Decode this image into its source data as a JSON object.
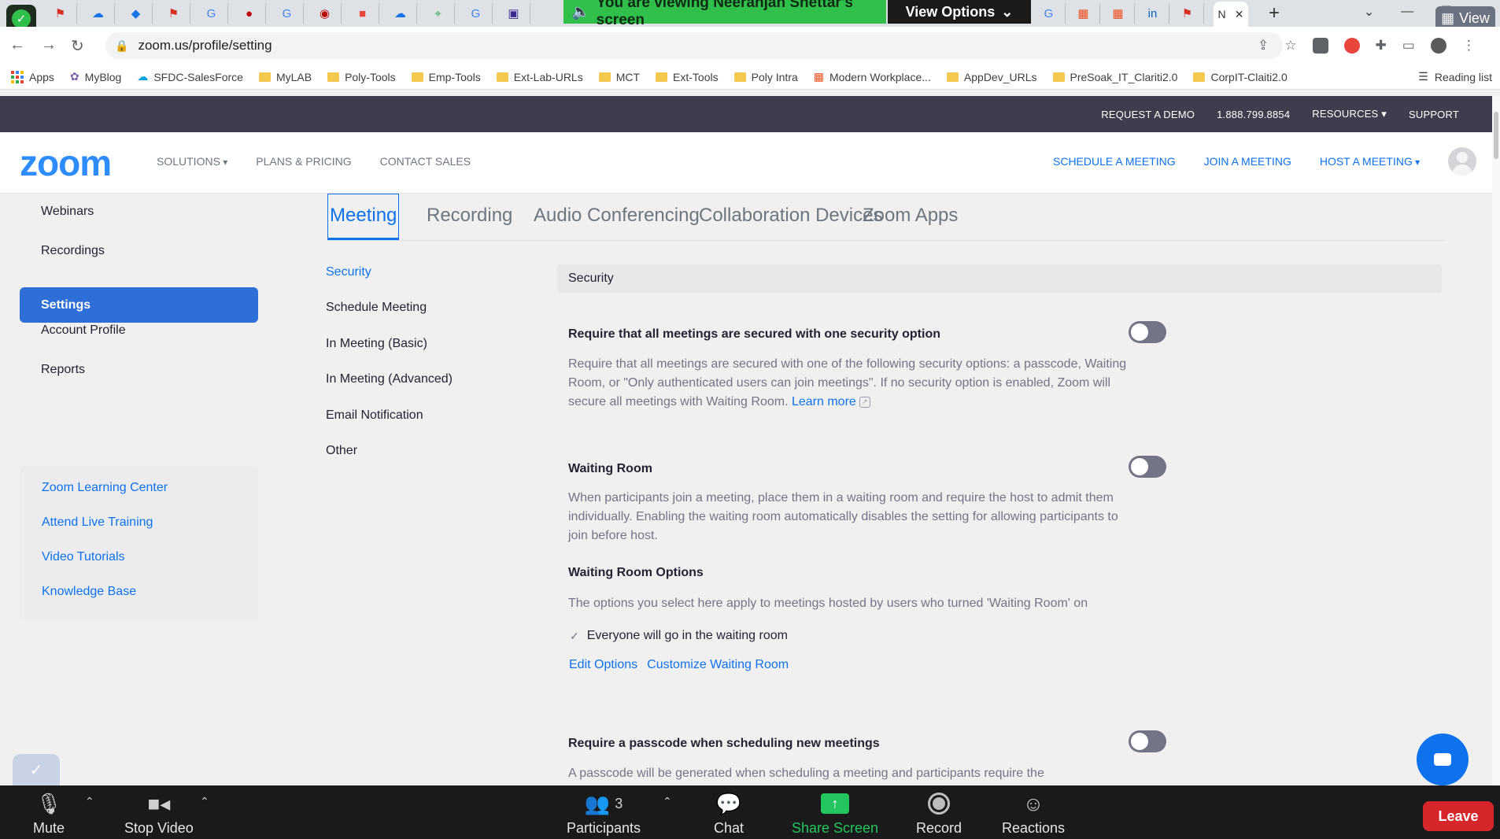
{
  "browser": {
    "viewing_banner": "You are viewing Neeranjan Shettar's screen",
    "view_options": "View Options",
    "view_chip": "View",
    "url": "zoom.us/profile/setting"
  },
  "bookmarks": [
    {
      "label": "Apps"
    },
    {
      "label": "MyBlog"
    },
    {
      "label": "SFDC-SalesForce"
    },
    {
      "label": "MyLAB"
    },
    {
      "label": "Poly-Tools"
    },
    {
      "label": "Emp-Tools"
    },
    {
      "label": "Ext-Lab-URLs"
    },
    {
      "label": "MCT"
    },
    {
      "label": "Ext-Tools"
    },
    {
      "label": "Poly Intra"
    },
    {
      "label": "Modern Workplace..."
    },
    {
      "label": "AppDev_URLs"
    },
    {
      "label": "PreSoak_IT_Clariti2.0"
    },
    {
      "label": "CorpIT-Claiti2.0"
    }
  ],
  "reading_list": "Reading list",
  "zoom_topbar": {
    "request_demo": "REQUEST A DEMO",
    "phone": "1.888.799.8854",
    "resources": "RESOURCES",
    "support": "SUPPORT"
  },
  "zoom_header": {
    "logo": "zoom",
    "solutions": "SOLUTIONS",
    "plans": "PLANS & PRICING",
    "contact": "CONTACT SALES",
    "schedule": "SCHEDULE A MEETING",
    "join": "JOIN A MEETING",
    "host": "HOST A MEETING"
  },
  "sidebar": {
    "items": [
      {
        "label": "Webinars"
      },
      {
        "label": "Recordings"
      },
      {
        "label": "Settings"
      },
      {
        "label": "Account Profile"
      },
      {
        "label": "Reports"
      }
    ],
    "help_links": [
      {
        "label": "Zoom Learning Center"
      },
      {
        "label": "Attend Live Training"
      },
      {
        "label": "Video Tutorials"
      },
      {
        "label": "Knowledge Base"
      }
    ]
  },
  "main": {
    "tabs": [
      {
        "label": "Meeting"
      },
      {
        "label": "Recording"
      },
      {
        "label": "Audio Conferencing"
      },
      {
        "label": "Collaboration Devices"
      },
      {
        "label": "Zoom Apps"
      }
    ],
    "sub_nav": [
      {
        "label": "Security"
      },
      {
        "label": "Schedule Meeting"
      },
      {
        "label": "In Meeting (Basic)"
      },
      {
        "label": "In Meeting (Advanced)"
      },
      {
        "label": "Email Notification"
      },
      {
        "label": "Other"
      }
    ],
    "section_header": "Security",
    "settings": [
      {
        "title": "Require that all meetings are secured with one security option",
        "desc": "Require that all meetings are secured with one of the following security options: a passcode, Waiting Room, or \"Only authenticated users can join meetings\". If no security option is enabled, Zoom will secure all meetings with Waiting Room.",
        "link": "Learn more",
        "enabled": false
      },
      {
        "title": "Waiting Room",
        "desc": "When participants join a meeting, place them in a waiting room and require the host to admit them individually. Enabling the waiting room automatically disables the setting for allowing participants to join before host.",
        "enabled": false
      },
      {
        "title": "Require a passcode when scheduling new meetings",
        "desc": "A passcode will be generated when scheduling a meeting and participants require the",
        "enabled": false
      }
    ],
    "waiting_room_options": {
      "title": "Waiting Room Options",
      "desc": "The options you select here apply to meetings hosted by users who turned 'Waiting Room' on",
      "check_item": "Everyone will go in the waiting room",
      "edit_options": "Edit Options",
      "customize": "Customize Waiting Room"
    }
  },
  "meeting_bar": {
    "mute": "Mute",
    "stop_video": "Stop Video",
    "participants": "Participants",
    "participant_count": "3",
    "chat": "Chat",
    "share_screen": "Share Screen",
    "record": "Record",
    "reactions": "Reactions",
    "leave": "Leave"
  },
  "colors": {
    "zoom_blue": "#0e72ed",
    "share_green": "#22c55e",
    "leave_red": "#d7262b",
    "toggle_off": "#747487"
  },
  "icons": [
    "shield-check-icon",
    "back-icon",
    "forward-icon",
    "reload-icon",
    "lock-icon",
    "share-icon",
    "star-icon",
    "extensions-icon",
    "microphone-icon",
    "video-camera-icon",
    "participants-icon",
    "chat-icon",
    "share-screen-icon",
    "record-icon",
    "reactions-icon",
    "chat-bubble-icon"
  ]
}
